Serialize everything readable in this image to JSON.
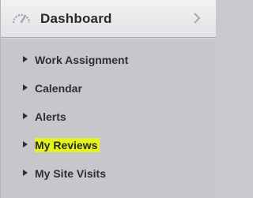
{
  "header": {
    "title": "Dashboard",
    "icon": "gauge-icon",
    "expand_icon": "chevron-right-icon"
  },
  "menu": {
    "items": [
      {
        "label": "Work Assignment",
        "highlighted": false
      },
      {
        "label": "Calendar",
        "highlighted": false
      },
      {
        "label": "Alerts",
        "highlighted": false
      },
      {
        "label": "My Reviews",
        "highlighted": true
      },
      {
        "label": "My Site Visits",
        "highlighted": false
      }
    ]
  },
  "colors": {
    "highlight": "#e6f21a",
    "panel": "#c7c7cb",
    "text": "#2f2f2f"
  }
}
